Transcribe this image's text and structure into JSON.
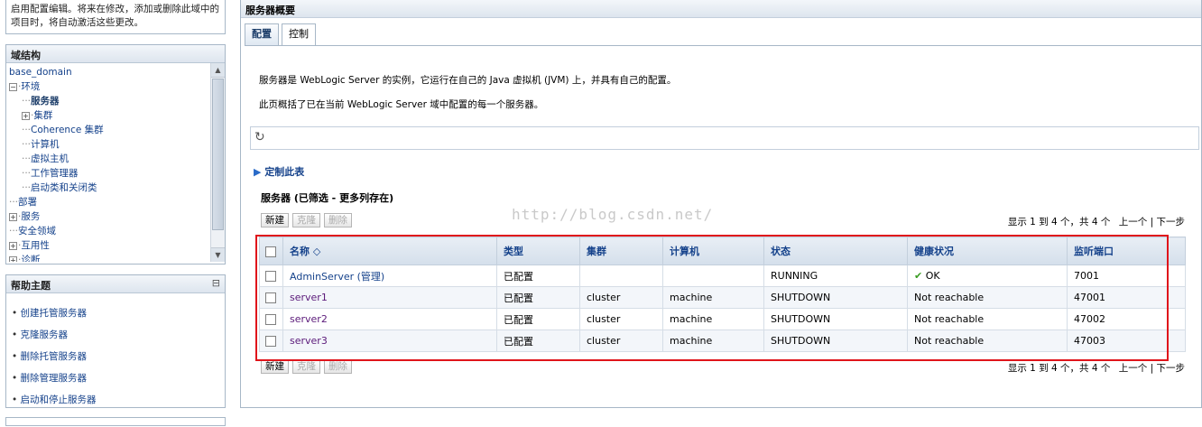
{
  "change_center": {
    "text": "启用配置编辑。将来在修改，添加或删除此域中的项目时，将自动激活这些更改。"
  },
  "domain_structure": {
    "title": "域结构",
    "root": "base_domain",
    "nodes": [
      {
        "label": "环境",
        "prefix": "plus-open"
      },
      {
        "label": "服务器",
        "prefix": "dots",
        "bold": true
      },
      {
        "label": "集群",
        "prefix": "plus"
      },
      {
        "label": "Coherence 集群",
        "prefix": "dots"
      },
      {
        "label": "计算机",
        "prefix": "dots"
      },
      {
        "label": "虚拟主机",
        "prefix": "dots"
      },
      {
        "label": "工作管理器",
        "prefix": "dots"
      },
      {
        "label": "启动类和关闭类",
        "prefix": "dots"
      },
      {
        "label": "部署",
        "prefix": "dots-top"
      },
      {
        "label": "服务",
        "prefix": "plus-top"
      },
      {
        "label": "安全领域",
        "prefix": "dots-top"
      },
      {
        "label": "互用性",
        "prefix": "plus-top"
      },
      {
        "label": "诊断",
        "prefix": "plus-top"
      }
    ]
  },
  "help": {
    "title": "帮助主题",
    "collapse": "⊟",
    "items": [
      "创建托管服务器",
      "克隆服务器",
      "删除托管服务器",
      "删除管理服务器",
      "启动和停止服务器"
    ]
  },
  "main": {
    "title": "服务器概要",
    "tabs": [
      "配置",
      "控制"
    ],
    "desc1": "服务器是 WebLogic Server 的实例，它运行在自己的 Java 虚拟机 (JVM) 上，并具有自己的配置。",
    "desc2": "此页概括了已在当前 WebLogic Server 域中配置的每一个服务器。",
    "refresh": "↻",
    "customize": "定制此表",
    "table_title": "服务器 (已筛选 - 更多列存在)",
    "buttons": {
      "new": "新建",
      "clone": "克隆",
      "delete": "删除"
    },
    "watermark": "http://blog.csdn.net/",
    "pager": {
      "summary": "显示 1 到 4 个，共 4 个",
      "prev": "上一个",
      "sep": "|",
      "next": "下一步"
    },
    "columns": [
      "名称 ◇",
      "类型",
      "集群",
      "计算机",
      "状态",
      "健康状况",
      "监听端口"
    ],
    "rows": [
      {
        "name": "AdminServer (管理)",
        "type": "已配置",
        "cluster": "",
        "machine": "",
        "state": "RUNNING",
        "health": "OK",
        "port": "7001"
      },
      {
        "name": "server1",
        "type": "已配置",
        "cluster": "cluster",
        "machine": "machine",
        "state": "SHUTDOWN",
        "health": "Not reachable",
        "port": "47001"
      },
      {
        "name": "server2",
        "type": "已配置",
        "cluster": "cluster",
        "machine": "machine",
        "state": "SHUTDOWN",
        "health": "Not reachable",
        "port": "47002"
      },
      {
        "name": "server3",
        "type": "已配置",
        "cluster": "cluster",
        "machine": "machine",
        "state": "SHUTDOWN",
        "health": "Not reachable",
        "port": "47003"
      }
    ],
    "colors": {
      "highlight": "#e0141b",
      "ok": "#3a9d23"
    }
  }
}
